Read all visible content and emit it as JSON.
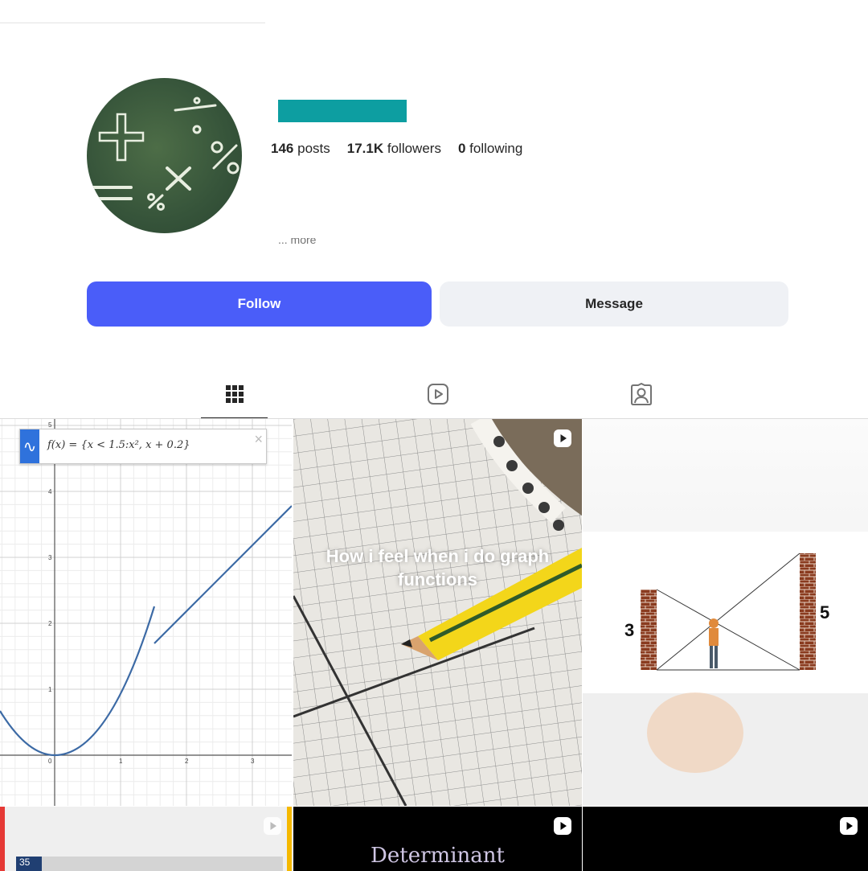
{
  "profile": {
    "stats": [
      {
        "value": "146",
        "label": "posts"
      },
      {
        "value": "17.1K",
        "label": "followers"
      },
      {
        "value": "0",
        "label": "following"
      }
    ],
    "more_label": "... more",
    "username_bar_color": "#0d9ea1"
  },
  "actions": {
    "follow_label": "Follow",
    "message_label": "Message",
    "follow_color": "#4a5df9"
  },
  "tabs": [
    {
      "name": "posts",
      "icon": "grid-icon",
      "active": true
    },
    {
      "name": "reels",
      "icon": "reels-icon",
      "active": false
    },
    {
      "name": "tagged",
      "icon": "tagged-icon",
      "active": false
    }
  ],
  "posts": [
    {
      "type": "image",
      "formula": "f(x) = {x < 1.5:x², x + 0.2}",
      "y_ticks": [
        "5",
        "4",
        "3",
        "2",
        "1",
        "0"
      ],
      "x_ticks": [
        "1",
        "2",
        "3"
      ]
    },
    {
      "type": "reel",
      "caption_line1": "How i feel when i do graph",
      "caption_line2": "functions"
    },
    {
      "type": "image",
      "left_label": "3",
      "right_label": "5"
    },
    {
      "type": "reel",
      "label": "35"
    },
    {
      "type": "reel",
      "title": "Determinant"
    },
    {
      "type": "reel"
    }
  ]
}
